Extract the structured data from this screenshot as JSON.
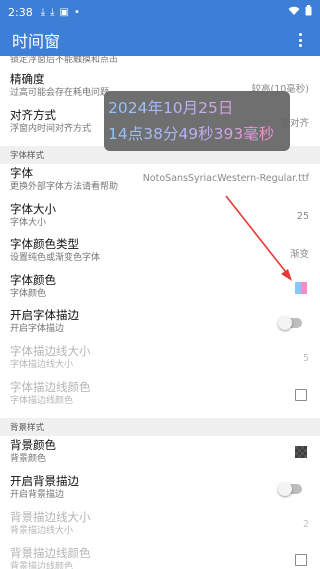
{
  "status_bar": {
    "time": "2:38"
  },
  "app_bar": {
    "title": "时间窗"
  },
  "rows": {
    "lock": {
      "subtitle": "锁定浮窗后不能触摸和点击"
    },
    "precision": {
      "title": "精确度",
      "subtitle": "过高可能会存在耗电问题",
      "value": "较高(10毫秒)"
    },
    "align": {
      "title": "对齐方式",
      "subtitle": "浮窗内时间对齐方式",
      "value": "左对齐"
    },
    "font": {
      "title": "字体",
      "subtitle": "更换外部字体方法请看帮助",
      "value": "NotoSansSyriacWestern-Regular.ttf"
    },
    "font_size": {
      "title": "字体大小",
      "subtitle": "字体大小",
      "value": "25"
    },
    "font_color_type": {
      "title": "字体颜色类型",
      "subtitle": "设置纯色或渐变色字体",
      "value": "渐变"
    },
    "font_color": {
      "title": "字体颜色",
      "subtitle": "字体颜色"
    },
    "font_stroke": {
      "title": "开启字体描边",
      "subtitle": "开启字体描边"
    },
    "font_stroke_size": {
      "title": "字体描边线大小",
      "subtitle": "字体描边线大小",
      "value": "5"
    },
    "font_stroke_color": {
      "title": "字体描边线颜色",
      "subtitle": "字体描边线颜色"
    },
    "bg_color": {
      "title": "背景颜色",
      "subtitle": "背景颜色"
    },
    "bg_stroke": {
      "title": "开启背景描边",
      "subtitle": "开启背景描边"
    },
    "bg_stroke_size": {
      "title": "背景描边线大小",
      "subtitle": "背景描边线大小",
      "value": "2"
    },
    "bg_stroke_color": {
      "title": "背景描边线颜色",
      "subtitle": "背景描边线颜色"
    }
  },
  "sections": {
    "font_style": "字体样式",
    "bg_style": "背景样式"
  },
  "overlay": {
    "date": "2024年10月25日",
    "time": "14点38分49秒393毫秒"
  },
  "colors": {
    "accent": "#3d7fd6",
    "gradient_start": "#8ec5ff",
    "gradient_end": "#ff86c8",
    "arrow": "#e53935"
  },
  "icons": [
    "download-icon",
    "download-icon",
    "image-icon",
    "dot-icon",
    "wifi-icon",
    "battery-icon",
    "more-vert-icon",
    "arrow-annotation"
  ]
}
